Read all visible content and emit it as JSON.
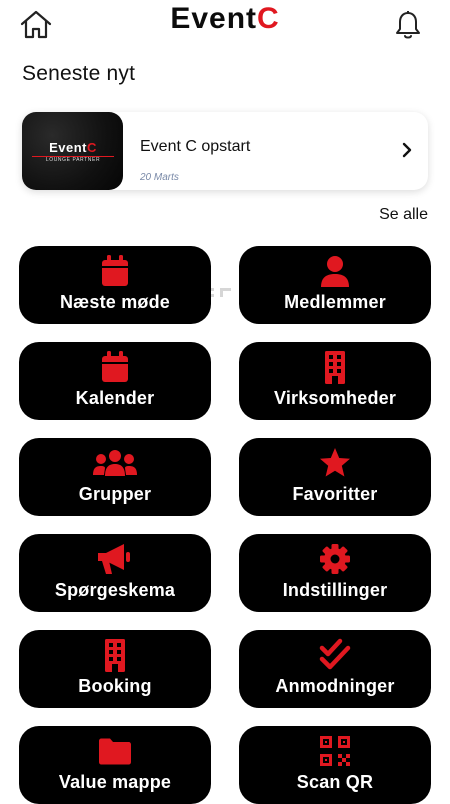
{
  "header": {
    "logo_main": "Event",
    "logo_accent": "C",
    "home_icon": "home-icon",
    "bell_icon": "bell-icon"
  },
  "news": {
    "section_title": "Seneste nyt",
    "see_all_label": "Se alle",
    "items": [
      {
        "title": "Event C opstart",
        "date": "20 Marts",
        "thumb_logo_main": "Event",
        "thumb_logo_accent": "C",
        "thumb_subtitle": "LOUNGE PARTNER"
      }
    ]
  },
  "tiles": [
    {
      "label": "Næste møde",
      "icon": "calendar-icon"
    },
    {
      "label": "Medlemmer",
      "icon": "person-icon"
    },
    {
      "label": "Kalender",
      "icon": "calendar-icon"
    },
    {
      "label": "Virksomheder",
      "icon": "building-icon"
    },
    {
      "label": "Grupper",
      "icon": "group-icon"
    },
    {
      "label": "Favoritter",
      "icon": "star-icon"
    },
    {
      "label": "Spørgeskema",
      "icon": "megaphone-icon"
    },
    {
      "label": "Indstillinger",
      "icon": "gear-icon"
    },
    {
      "label": "Booking",
      "icon": "building-icon"
    },
    {
      "label": "Anmodninger",
      "icon": "double-check-icon"
    },
    {
      "label": "Value mappe",
      "icon": "folder-icon"
    },
    {
      "label": "Scan QR",
      "icon": "qr-code-icon"
    }
  ],
  "colors": {
    "accent": "#e01820",
    "tile_background": "#000000",
    "tile_text": "#ffffff",
    "date_text": "#7a8aa8"
  }
}
